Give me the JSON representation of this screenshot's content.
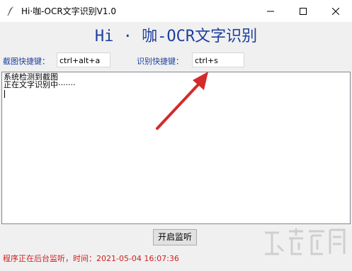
{
  "window": {
    "title": "Hi·咖-OCR文字识别V1.0",
    "icon": "feather-icon"
  },
  "controls": {
    "minimize": "minimize-icon",
    "maximize": "maximize-icon",
    "close": "close-icon"
  },
  "heading": "Hi · 咖-OCR文字识别",
  "hotkeys": {
    "screenshot_label": "截图快捷键：",
    "screenshot_value": "ctrl+alt+a",
    "recognize_label": "识别快捷键：",
    "recognize_value": "ctrl+s"
  },
  "log": {
    "lines": [
      "系统检测到截图",
      "正在文字识别中·······"
    ]
  },
  "start_button": "开启监听",
  "status": "程序正在后台监听，时间：2021-05-04 16:07:36",
  "colors": {
    "accent": "#1e3fa0",
    "status": "#d02020",
    "arrow": "#d42a2a"
  }
}
